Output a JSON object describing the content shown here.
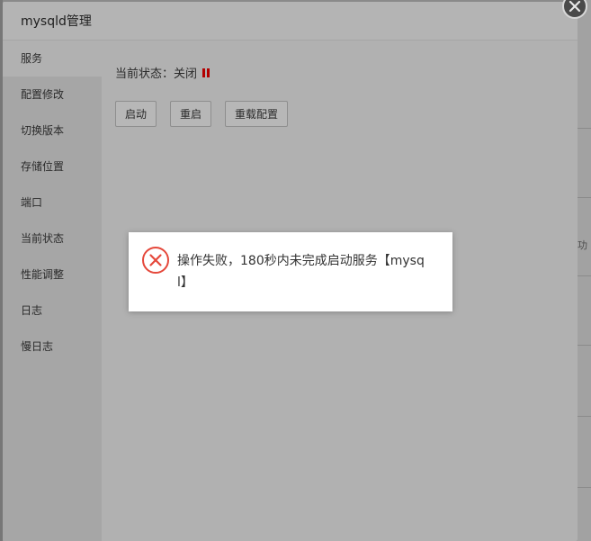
{
  "background": {
    "edge_text": "功"
  },
  "modal": {
    "title": "mysqld管理",
    "sidebar": {
      "items": [
        {
          "label": "服务",
          "active": true
        },
        {
          "label": "配置修改",
          "active": false
        },
        {
          "label": "切换版本",
          "active": false
        },
        {
          "label": "存储位置",
          "active": false
        },
        {
          "label": "端口",
          "active": false
        },
        {
          "label": "当前状态",
          "active": false
        },
        {
          "label": "性能调整",
          "active": false
        },
        {
          "label": "日志",
          "active": false
        },
        {
          "label": "慢日志",
          "active": false
        }
      ]
    },
    "service": {
      "status_label": "当前状态：",
      "status_value": "关闭",
      "status_icon": "pause-icon",
      "status_color": "#b30000",
      "buttons": {
        "start": "启动",
        "restart": "重启",
        "reload": "重载配置"
      }
    },
    "close_icon": "close-icon"
  },
  "toast": {
    "icon": "error-circle-icon",
    "icon_color": "#e5483b",
    "message": "操作失败，180秒内未完成启动服务【mysql】"
  }
}
